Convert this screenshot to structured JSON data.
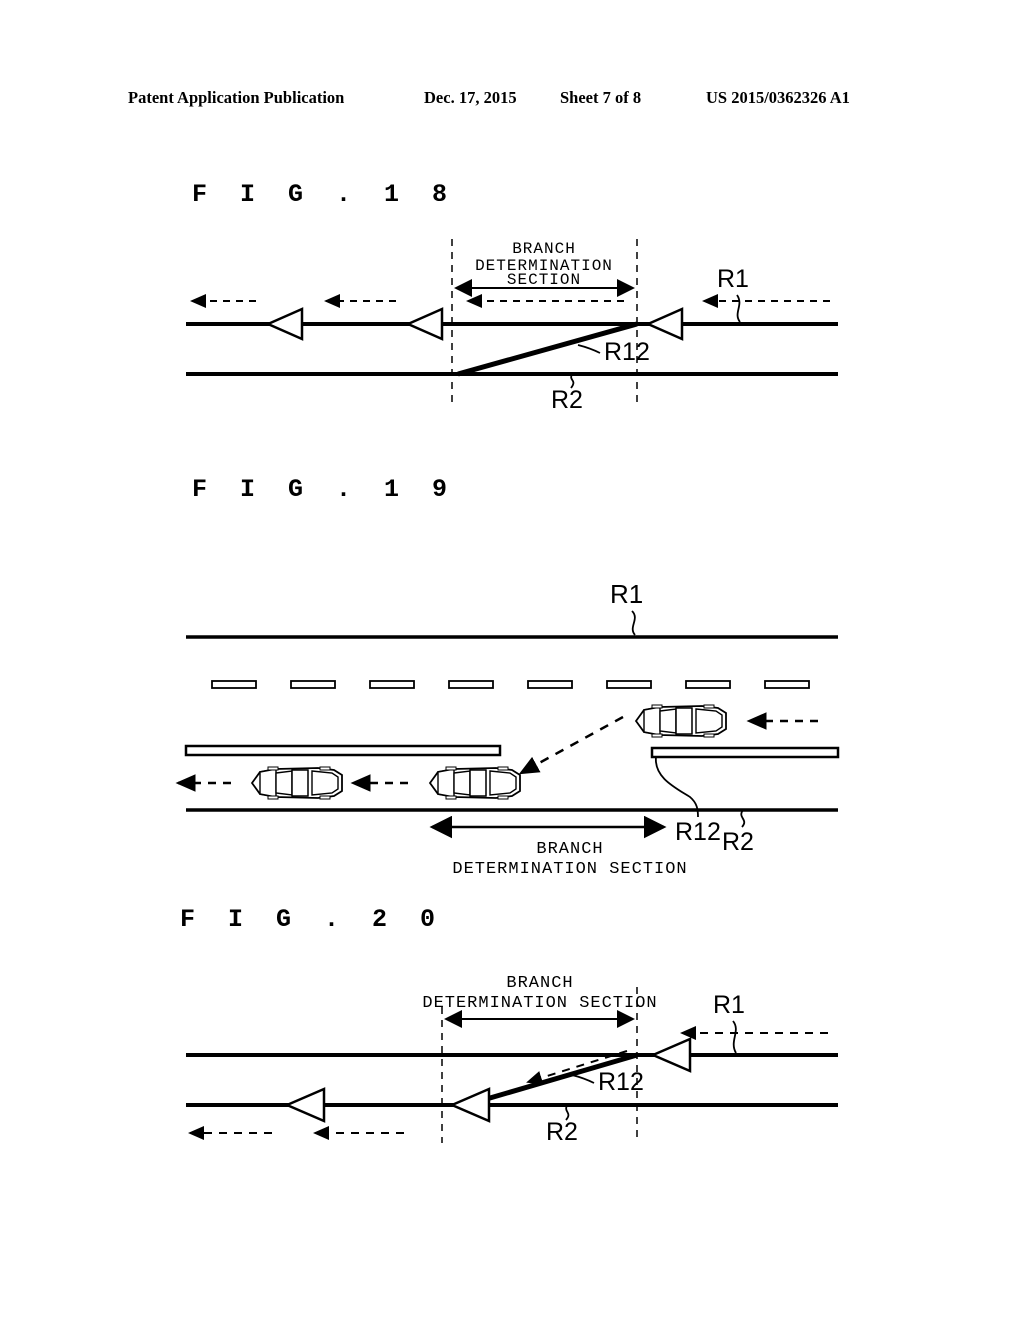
{
  "header": {
    "publication": "Patent Application Publication",
    "date": "Dec. 17, 2015",
    "sheet": "Sheet 7 of 8",
    "patent_number": "US 2015/0362326 A1"
  },
  "figures": [
    {
      "caption": "F I G .   1 8",
      "labels": {
        "section_line1": "BRANCH",
        "section_line2": "DETERMINATION",
        "section_line3": "SECTION",
        "road_main": "R1",
        "road_branch": "R12",
        "road_secondary": "R2"
      }
    },
    {
      "caption": "F I G .   1 9",
      "labels": {
        "section_line1": "BRANCH",
        "section_line2": "DETERMINATION SECTION",
        "road_main": "R1",
        "road_branch": "R12",
        "road_secondary": "R2"
      }
    },
    {
      "caption": "F I G .   2 0",
      "labels": {
        "section_line1": "BRANCH",
        "section_line2": "DETERMINATION SECTION",
        "road_main": "R1",
        "road_branch": "R12",
        "road_secondary": "R2"
      }
    }
  ]
}
